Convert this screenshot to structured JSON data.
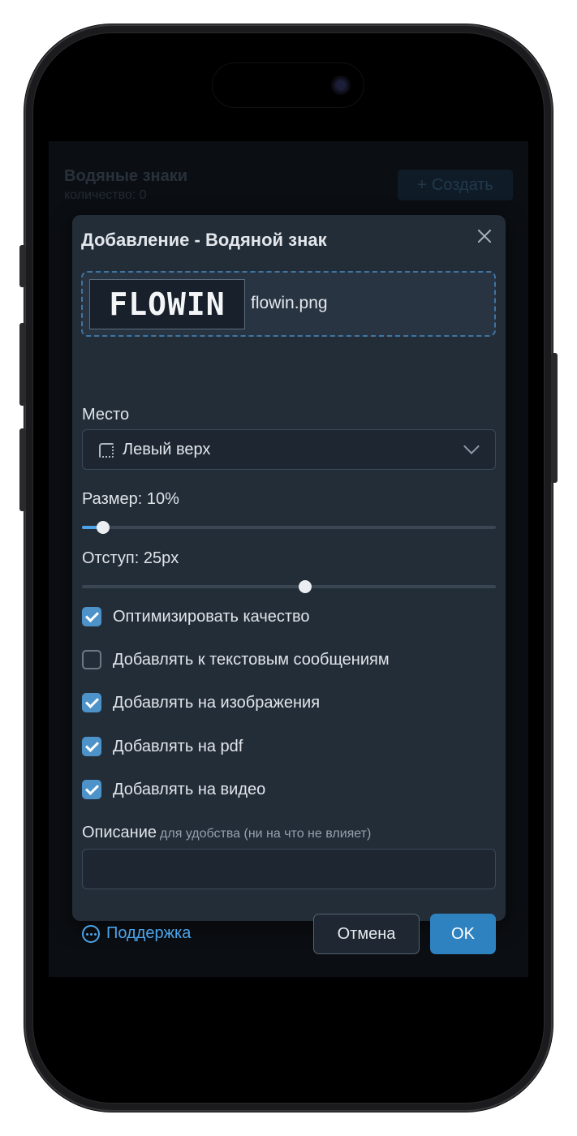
{
  "background_page": {
    "title": "Водяные знаки",
    "count_label": "количество: 0",
    "create_button": "Создать"
  },
  "modal": {
    "title": "Добавление - Водяной знак",
    "upload": {
      "logo_text": "FLOWIN",
      "file_name": "flowin.png"
    },
    "position": {
      "label": "Место",
      "selected": "Левый верх"
    },
    "size_slider": {
      "label": "Размер: 10%",
      "value_fraction": 0.05
    },
    "offset_slider": {
      "label": "Отступ: 25px",
      "value_fraction": 0.54
    },
    "checkboxes": [
      {
        "label": "Оптимизировать качество",
        "checked": true
      },
      {
        "label": "Добавлять к текстовым сообщениям",
        "checked": false
      },
      {
        "label": "Добавлять на изображения",
        "checked": true
      },
      {
        "label": "Добавлять на pdf",
        "checked": true
      },
      {
        "label": "Добавлять на видео",
        "checked": true
      }
    ],
    "description": {
      "label": "Описание",
      "hint": "для удобства (ни на что не влияет)",
      "value": ""
    },
    "footer": {
      "support_label": "Поддержка",
      "cancel_label": "Отмена",
      "ok_label": "OK"
    }
  },
  "colors": {
    "accent": "#4da3e8",
    "primary_button": "#2f82c0",
    "modal_bg": "#232d38"
  }
}
